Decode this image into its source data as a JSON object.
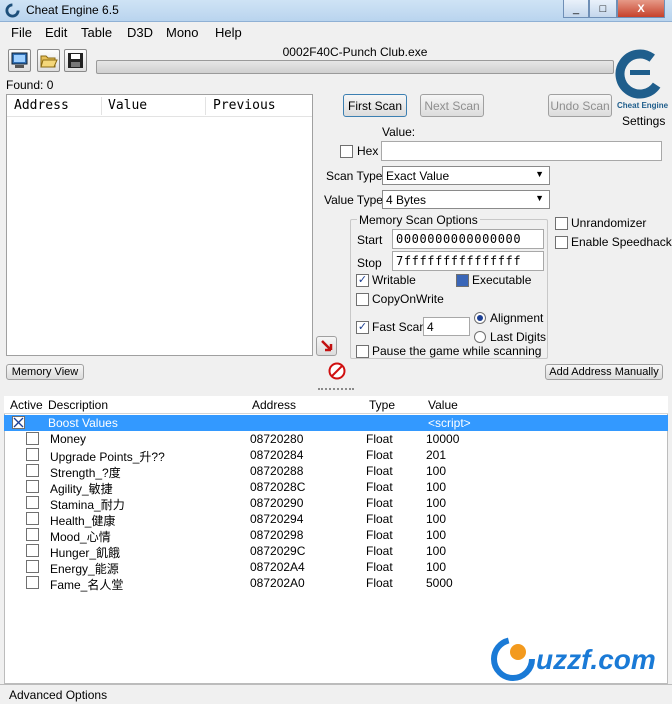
{
  "window": {
    "title": "Cheat Engine 6.5",
    "minimize": "_",
    "maximize": "□",
    "close": "X"
  },
  "menu": [
    "File",
    "Edit",
    "Table",
    "D3D",
    "Mono",
    "Help"
  ],
  "process": "0002F40C-Punch Club.exe",
  "found": "Found: 0",
  "results_headers": [
    "Address",
    "Value",
    "Previous"
  ],
  "logo": {
    "text": "Cheat Engine",
    "settings": "Settings"
  },
  "scan": {
    "first_scan": "First Scan",
    "next_scan": "Next Scan",
    "undo_scan": "Undo Scan",
    "value_label": "Value:",
    "value": "",
    "hex": "Hex",
    "scan_type_label": "Scan Type",
    "scan_type": "Exact Value",
    "value_type_label": "Value Type",
    "value_type": "4 Bytes"
  },
  "mem_options": {
    "title": "Memory Scan Options",
    "start_label": "Start",
    "start": "0000000000000000",
    "stop_label": "Stop",
    "stop": "7fffffffffffffff",
    "writable": "Writable",
    "executable": "Executable",
    "copyonwrite": "CopyOnWrite",
    "fast_scan": "Fast Scan",
    "fast_scan_value": "4",
    "alignment": "Alignment",
    "last_digits": "Last Digits",
    "pause": "Pause the game while scanning"
  },
  "right_options": {
    "unrandomizer": "Unrandomizer",
    "speedhack": "Enable Speedhack"
  },
  "memory_view": "Memory View",
  "add_address": "Add Address Manually",
  "table": {
    "headers": [
      "Active",
      "Description",
      "Address",
      "Type",
      "Value"
    ],
    "group": {
      "description": "Boost Values",
      "value": "<script>"
    },
    "rows": [
      {
        "description": "Money",
        "address": "08720280",
        "type": "Float",
        "value": "10000"
      },
      {
        "description": "Upgrade Points_升??",
        "address": "08720284",
        "type": "Float",
        "value": "201"
      },
      {
        "description": "Strength_?度",
        "address": "08720288",
        "type": "Float",
        "value": "100"
      },
      {
        "description": "Agility_敏捷",
        "address": "0872028C",
        "type": "Float",
        "value": "100"
      },
      {
        "description": "Stamina_耐力",
        "address": "08720290",
        "type": "Float",
        "value": "100"
      },
      {
        "description": "Health_健康",
        "address": "08720294",
        "type": "Float",
        "value": "100"
      },
      {
        "description": "Mood_心情",
        "address": "08720298",
        "type": "Float",
        "value": "100"
      },
      {
        "description": "Hunger_飢餓",
        "address": "0872029C",
        "type": "Float",
        "value": "100"
      },
      {
        "description": "Energy_能源",
        "address": "087202A4",
        "type": "Float",
        "value": "100"
      },
      {
        "description": "Fame_名人堂",
        "address": "087202A0",
        "type": "Float",
        "value": "5000"
      }
    ]
  },
  "advanced_options": "Advanced Options",
  "watermark": "uzzf.com",
  "colors": {
    "selection": "#3399ff",
    "accent": "#1c3f94"
  }
}
